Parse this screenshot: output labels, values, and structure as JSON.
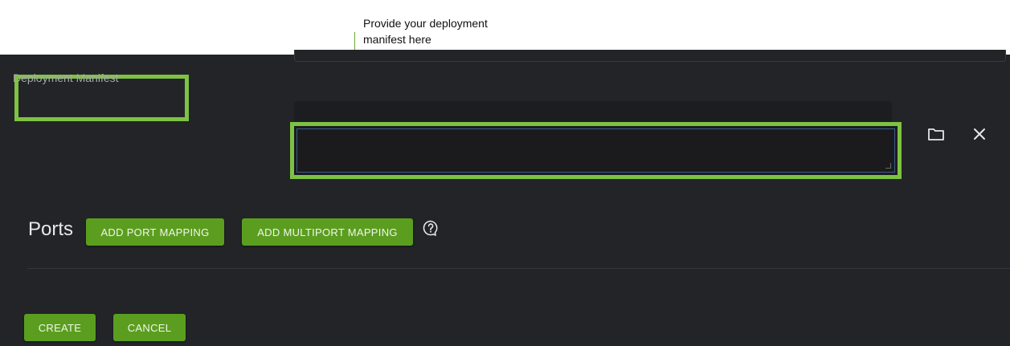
{
  "annotation": {
    "text": "Provide your deployment manifest here",
    "highlight_color": "#7dc242"
  },
  "form": {
    "manifest_label": "Deployment Manifest",
    "manifest_value": "",
    "icons": {
      "browse": "folder-icon",
      "clear": "close-icon"
    }
  },
  "ports": {
    "title": "Ports",
    "add_port_mapping": "ADD PORT MAPPING",
    "add_multiport_mapping": "ADD MULTIPORT MAPPING",
    "help_icon": "help-icon"
  },
  "actions": {
    "create": "CREATE",
    "cancel": "CANCEL"
  },
  "colors": {
    "background": "#232428",
    "button": "#5b9e1f",
    "highlight": "#7dc242"
  }
}
